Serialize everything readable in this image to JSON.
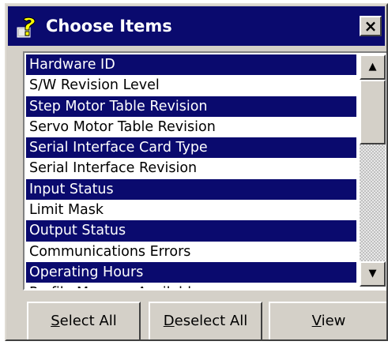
{
  "window": {
    "title": "Choose Items",
    "close_label": "×"
  },
  "colors": {
    "titlebar": "#0a0a6e",
    "selection": "#0a0a6e",
    "face": "#d4d0c8"
  },
  "list": {
    "items": [
      {
        "label": "Hardware ID",
        "selected": true
      },
      {
        "label": "S/W Revision Level",
        "selected": false
      },
      {
        "label": "Step Motor Table Revision",
        "selected": true
      },
      {
        "label": "Servo Motor Table Revision",
        "selected": false
      },
      {
        "label": "Serial Interface Card Type",
        "selected": true
      },
      {
        "label": "Serial Interface Revision",
        "selected": false
      },
      {
        "label": "Input Status",
        "selected": true
      },
      {
        "label": "Limit Mask",
        "selected": false
      },
      {
        "label": "Output Status",
        "selected": true
      },
      {
        "label": "Communications Errors",
        "selected": false
      },
      {
        "label": "Operating Hours",
        "selected": true
      },
      {
        "label": "Profile Memory Available",
        "selected": false
      }
    ]
  },
  "scrollbar": {
    "up_arrow": "▲",
    "down_arrow": "▼"
  },
  "buttons": {
    "select_all": {
      "hotkey": "S",
      "rest": "elect All"
    },
    "deselect_all": {
      "hotkey": "D",
      "rest": "eselect All"
    },
    "view": {
      "hotkey": "V",
      "rest": "iew"
    }
  }
}
